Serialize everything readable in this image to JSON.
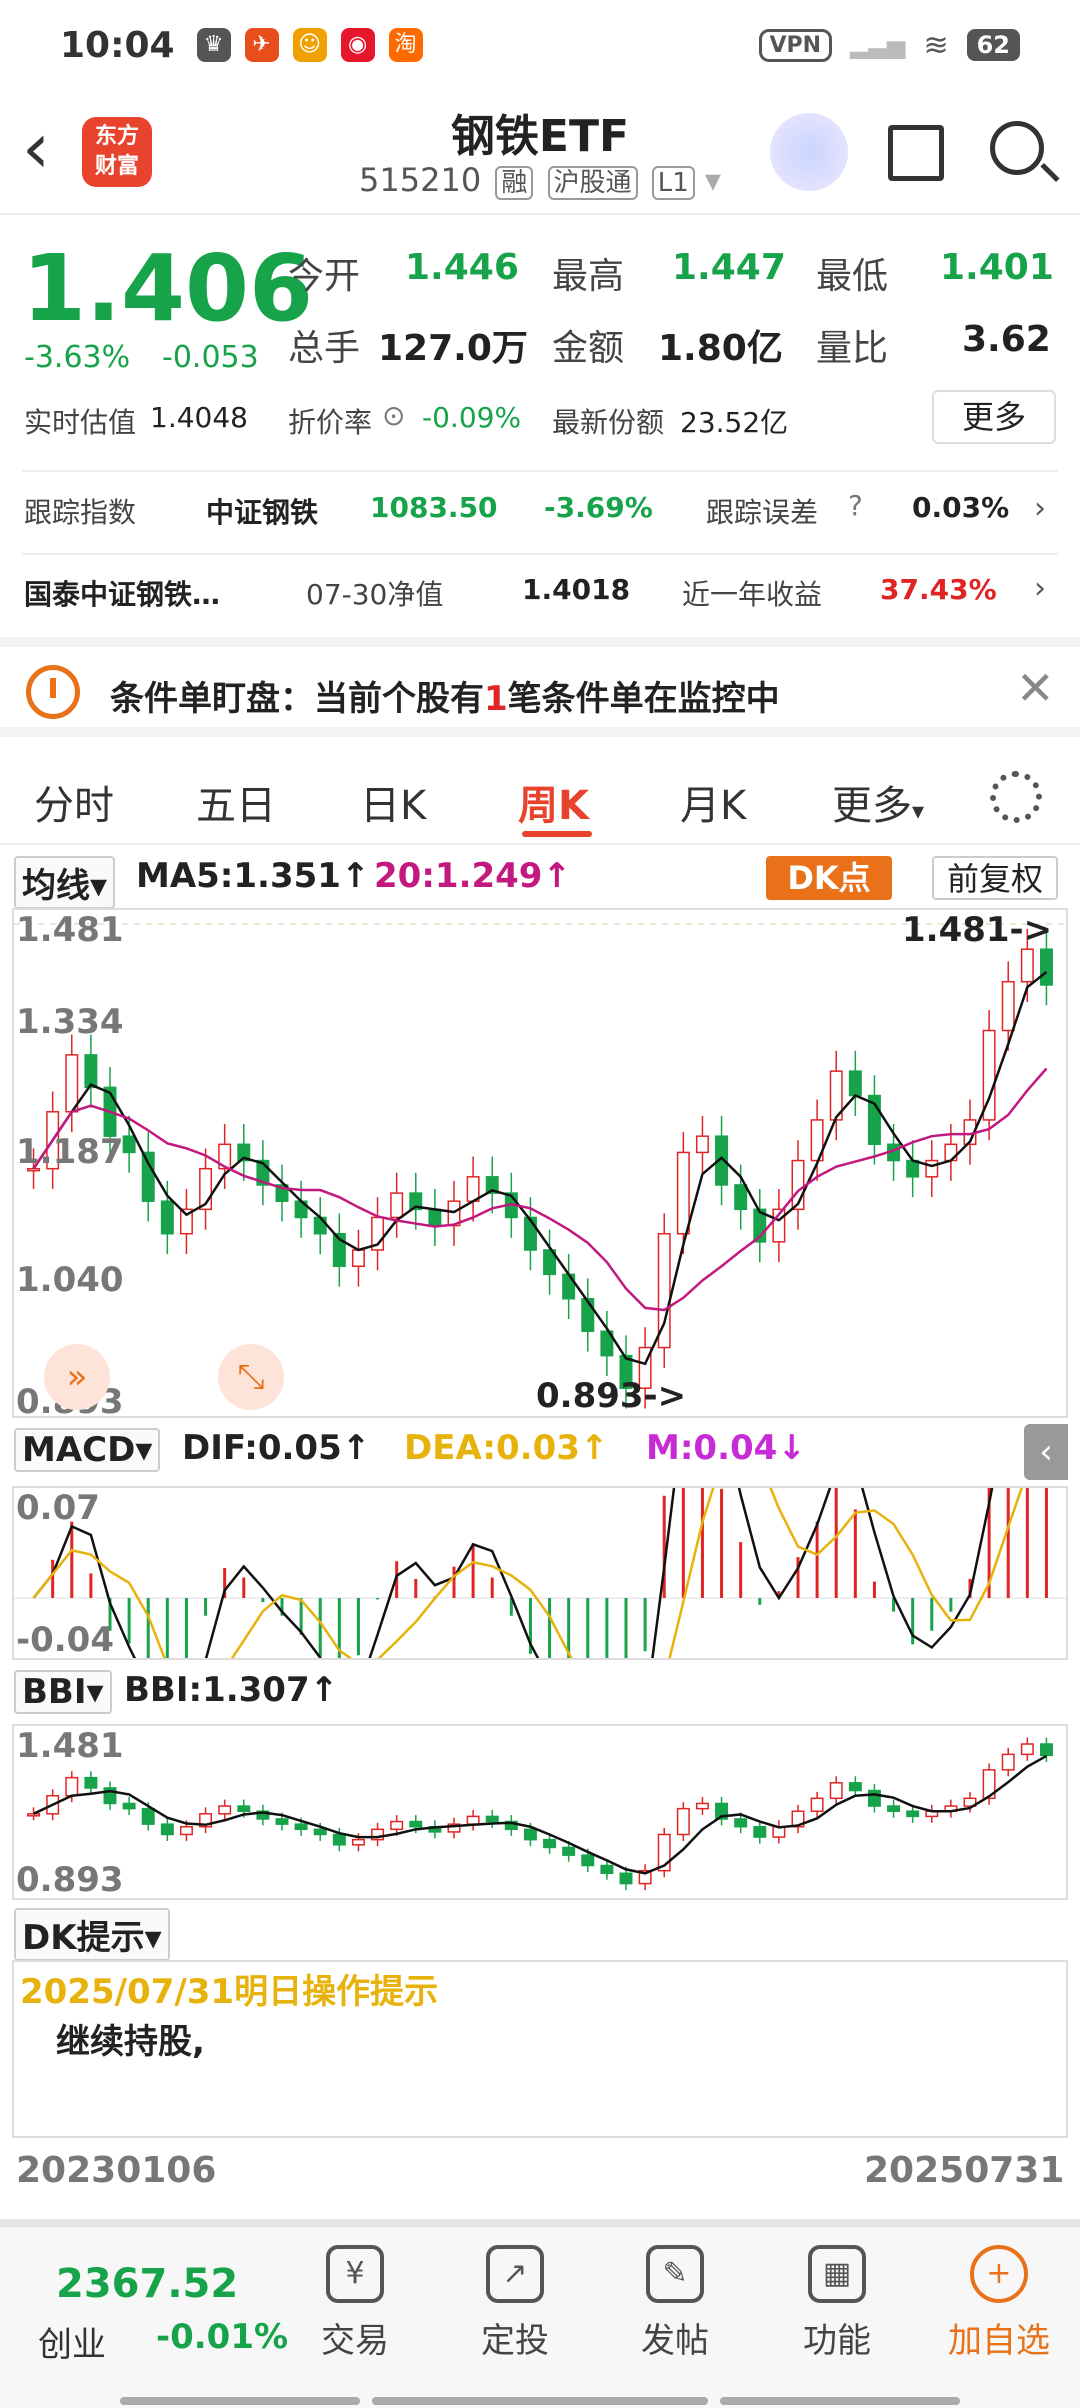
{
  "status_bar": {
    "time": "10:04",
    "vpn": "VPN",
    "battery": "62"
  },
  "header": {
    "logo": "东方\n财富",
    "title": "钢铁ETF",
    "code": "515210",
    "tags": [
      "融",
      "沪股通",
      "L1"
    ]
  },
  "quote": {
    "price": "1.406",
    "change_pct": "-3.63%",
    "change": "-0.053",
    "open_label": "今开",
    "open": "1.446",
    "high_label": "最高",
    "high": "1.447",
    "low_label": "最低",
    "low": "1.401",
    "vol_label": "总手",
    "vol": "127.0万",
    "amount_label": "金额",
    "amount": "1.80亿",
    "ratio_label": "量比",
    "ratio": "3.62",
    "iopv_label": "实时估值",
    "iopv": "1.4048",
    "discount_label": "折价率",
    "discount": "-0.09%",
    "shares_label": "最新份额",
    "shares": "23.52亿",
    "more": "更多"
  },
  "tracking": {
    "label": "跟踪指数",
    "index_name": "中证钢铁",
    "index_value": "1083.50",
    "index_chg": "-3.69%",
    "error_label": "跟踪误差",
    "error_value": "0.03%"
  },
  "fund": {
    "name": "国泰中证钢铁…",
    "nav_label": "07-30净值",
    "nav": "1.4018",
    "ret_label": "近一年收益",
    "ret": "37.43%"
  },
  "alert": {
    "text_pre": "条件单盯盘：当前个股有",
    "count": "1",
    "text_post": "笔条件单在监控中"
  },
  "tabs": [
    "分时",
    "五日",
    "日K",
    "周K",
    "月K",
    "更多"
  ],
  "chart": {
    "ma_select": "均线",
    "ma5": "MA5:1.351↑",
    "ma20": "20:1.249↑",
    "dk_button": "DK点",
    "fq_button": "前复权",
    "y_top": "1.481",
    "y_2": "1.334",
    "y_3": "1.187",
    "y_4": "1.040",
    "y_bottom": "0.893",
    "max_marker": "1.481->",
    "min_marker": "0.893->",
    "macd_select": "MACD",
    "dif": "DIF:0.05↑",
    "dea": "DEA:0.03↑",
    "m": "M:0.04↓",
    "macd_top": "0.07",
    "macd_bottom": "-0.04",
    "bbi_select": "BBI",
    "bbi": "BBI:1.307↑",
    "bbi_top": "1.481",
    "bbi_bottom": "0.893",
    "dk_hint_select": "DK提示",
    "hint_date": "2025/07/31明日操作提示",
    "hint_text": "继续持股,",
    "start_date": "20230106",
    "end_date": "20250731"
  },
  "chart_data": {
    "type": "candlestick",
    "period": "weekly",
    "ylim": [
      0.893,
      1.481
    ],
    "close_path": [
      1.18,
      1.25,
      1.32,
      1.28,
      1.22,
      1.2,
      1.14,
      1.1,
      1.13,
      1.18,
      1.21,
      1.19,
      1.16,
      1.14,
      1.12,
      1.1,
      1.06,
      1.08,
      1.12,
      1.15,
      1.13,
      1.11,
      1.14,
      1.17,
      1.15,
      1.12,
      1.08,
      1.05,
      1.02,
      0.98,
      0.95,
      0.91,
      0.96,
      1.1,
      1.2,
      1.22,
      1.16,
      1.13,
      1.09,
      1.13,
      1.19,
      1.24,
      1.3,
      1.27,
      1.21,
      1.19,
      1.17,
      1.19,
      1.21,
      1.24,
      1.35,
      1.41,
      1.45,
      1.406
    ],
    "macd_range": [
      -0.04,
      0.07
    ],
    "bbi_value": 1.307
  },
  "bottom_nav": {
    "index_value": "2367.52",
    "index_name": "创业",
    "index_chg": "-0.01%",
    "items": [
      "交易",
      "定投",
      "发帖",
      "功能",
      "加自选"
    ]
  }
}
